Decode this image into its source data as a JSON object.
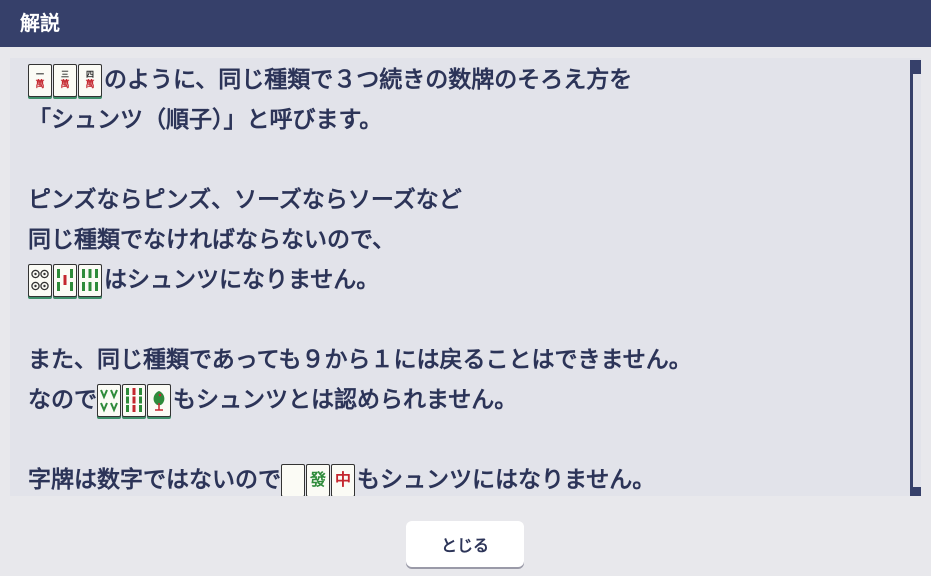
{
  "header": {
    "title": "解説"
  },
  "body": {
    "line1": "のように、同じ種類で３つ続きの数牌のそろえ方を",
    "line2": "「シュンツ（順子）」と呼びます。",
    "line4": "ピンズならピンズ、ソーズならソーズなど",
    "line5": "同じ種類でなければならないので、",
    "line6": "はシュンツになりません。",
    "line8": "また、同じ種類であっても９から１には戻ることはできません。",
    "line9_a": "なので",
    "line9_b": "もシュンツとは認められません。",
    "line11_a": "字牌は数字ではないので",
    "line11_b": "もシュンツにはなりません。"
  },
  "tiles": {
    "man": [
      {
        "top": "一",
        "bottom": "萬"
      },
      {
        "top": "三",
        "bottom": "萬"
      },
      {
        "top": "四",
        "bottom": "萬"
      }
    ],
    "honor_green": "發",
    "honor_red": "中"
  },
  "footer": {
    "close_label": "とじる"
  },
  "colors": {
    "header_bg": "#36406a",
    "text": "#2c3458",
    "panel_bg": "#e2e3ea",
    "page_bg": "#e8e8ec",
    "tile_shadow": "#3f8f6a"
  }
}
